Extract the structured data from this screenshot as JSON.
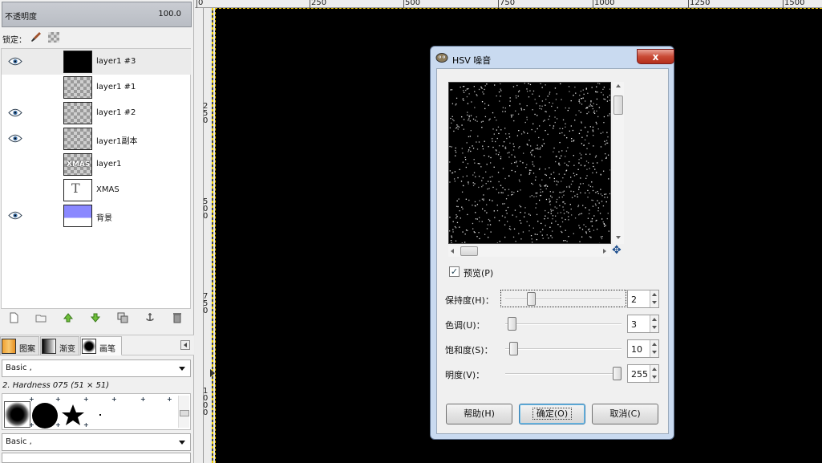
{
  "layers_panel": {
    "opacity_label": "不透明度",
    "opacity_value": "100.0",
    "lock_label": "锁定：",
    "layers": [
      {
        "name": "layer1 #3",
        "visible": true,
        "selected": true,
        "thumb": "black"
      },
      {
        "name": "layer1 #1",
        "visible": false,
        "selected": false,
        "thumb": "checker"
      },
      {
        "name": "layer1 #2",
        "visible": true,
        "selected": false,
        "thumb": "checker"
      },
      {
        "name": "layer1副本",
        "visible": true,
        "selected": false,
        "thumb": "checker-text"
      },
      {
        "name": "layer1",
        "visible": false,
        "selected": false,
        "thumb": "checker-xmas"
      },
      {
        "name": "XMAS",
        "visible": false,
        "selected": false,
        "thumb": "text-layer"
      },
      {
        "name": "背景",
        "visible": true,
        "selected": false,
        "thumb": "blue-gradient"
      }
    ],
    "thumb_text_xmas": "XMAS",
    "thumb_text_t": "T"
  },
  "dock_tabs": [
    {
      "label": "图案",
      "icon": "pattern-icon"
    },
    {
      "label": "渐变",
      "icon": "gradient-icon"
    },
    {
      "label": "画笔",
      "icon": "brush-icon"
    }
  ],
  "brushes": {
    "tag_filter_1": "Basic ,",
    "selected_brush": "2. Hardness 075 (51 × 51)",
    "tag_filter_2": "Basic ,"
  },
  "rulers": {
    "h_ticks": [
      "0",
      "250",
      "500",
      "750",
      "1000",
      "1250",
      "1500"
    ],
    "v_ticks": [
      "250",
      "500",
      "750",
      "1000"
    ]
  },
  "dialog": {
    "title": "HSV 噪音",
    "close_symbol": "x",
    "preview_label": "预览(P)",
    "preview_checked": true,
    "sliders": [
      {
        "label": "保持度(H)：",
        "value": "2",
        "fraction": 0.2
      },
      {
        "label": "色调(U)：",
        "value": "3",
        "fraction": 0.02
      },
      {
        "label": "饱和度(S)：",
        "value": "10",
        "fraction": 0.04
      },
      {
        "label": "明度(V)：",
        "value": "255",
        "fraction": 1.0
      }
    ],
    "buttons": {
      "help": "帮助(H)",
      "ok": "确定(O)",
      "cancel": "取消(C)"
    }
  },
  "colors": {
    "canvas": "#000000",
    "dialog_frame": "#c9daf0",
    "close_button": "#c94a35",
    "selection_marquee": "#e8c200"
  }
}
